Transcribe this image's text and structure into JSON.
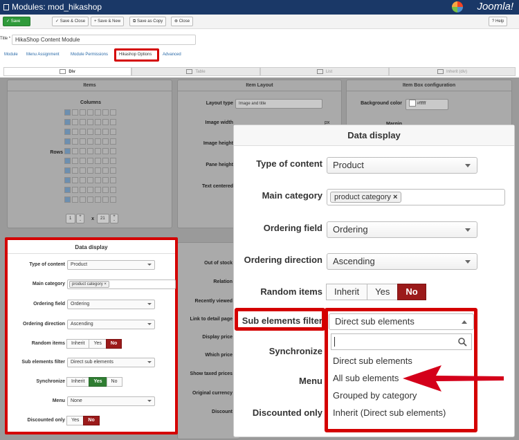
{
  "window": {
    "title": "Modules: mod_hikashop",
    "brand": "Joomla!"
  },
  "toolbar": {
    "save": "Save",
    "save_close": "Save & Close",
    "save_new": "Save & New",
    "save_copy": "Save as Copy",
    "close": "Close",
    "help": "Help"
  },
  "title_field": {
    "label": "Title *",
    "value": "HikaShop Content Module"
  },
  "tabs": [
    "Module",
    "Menu Assignment",
    "Module Permissions",
    "Hikashop Options",
    "Advanced"
  ],
  "layout_tabs": [
    "Div",
    "Table",
    "List",
    "Inherit (div)"
  ],
  "panels": {
    "items": {
      "title": "Items",
      "columns": "Columns",
      "rows": "Rows",
      "rows_value": "1",
      "cols_value": "21",
      "times": "x",
      "plus": "+",
      "minus": "-"
    },
    "item_layout": {
      "title": "Item Layout",
      "layout_type": "Layout type",
      "layout_value": "Image and title",
      "image_width": "Image width",
      "image_height": "Image height",
      "pane_height": "Pane height",
      "text_centered": "Text centered",
      "px": "px"
    },
    "item_box": {
      "title": "Item Box configuration",
      "bg_color": "Background color",
      "bg_value": "#ffffff",
      "margin": "Margin"
    },
    "behind": {
      "out_of_stock": "Out of stock",
      "relation": "Relation",
      "recently_viewed": "Recently viewed",
      "link_detail": "Link to detail page",
      "display_price": "Display price",
      "which_price": "Which price",
      "show_taxed": "Show taxed prices",
      "original_currency": "Original currency",
      "discount": "Discount"
    }
  },
  "data_display": {
    "title": "Data display",
    "type_of_content": {
      "label": "Type of content",
      "value": "Product"
    },
    "main_category": {
      "label": "Main category",
      "tag": "product category"
    },
    "ordering_field": {
      "label": "Ordering field",
      "value": "Ordering"
    },
    "ordering_direction": {
      "label": "Ordering direction",
      "value": "Ascending"
    },
    "random_items": {
      "label": "Random items",
      "options": [
        "Inherit",
        "Yes",
        "No"
      ],
      "selected": "No"
    },
    "sub_elements_filter": {
      "label": "Sub elements filter",
      "value": "Direct sub elements",
      "options": [
        "Direct sub elements",
        "All sub elements",
        "Grouped by category",
        "Inherit (Direct sub elements)"
      ]
    },
    "synchronize": {
      "label": "Synchronize",
      "options": [
        "Inherit",
        "Yes",
        "No"
      ],
      "selected": "Yes"
    },
    "menu": {
      "label": "Menu",
      "value": "None"
    },
    "discounted_only": {
      "label": "Discounted only",
      "options": [
        "Yes",
        "No"
      ],
      "selected": "No"
    }
  },
  "colors": {
    "header": "#1a3867",
    "save_green": "#2f9a3a",
    "highlight_red": "#d40000",
    "no_red": "#9b1a1a",
    "yes_green": "#2f7d32",
    "arrow_red": "#d4001a"
  }
}
